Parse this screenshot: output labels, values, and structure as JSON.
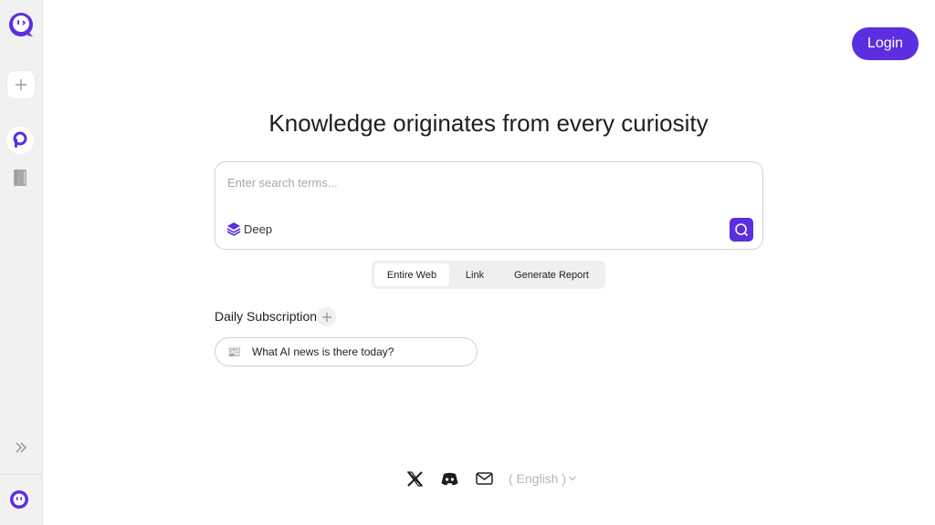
{
  "colors": {
    "accent": "#5b2ee0",
    "sidebar_bg": "#f1f1f1"
  },
  "sidebar": {
    "logo_icon": "robot-face-logo-icon",
    "new_icon": "plus-icon",
    "app_icon": "p-logo-icon",
    "library_icon": "book-icon",
    "expand_icon": "double-chevron-right-icon",
    "avatar_icon": "robot-face-avatar-icon"
  },
  "header": {
    "login_label": "Login"
  },
  "main": {
    "title": "Knowledge originates from every curiosity",
    "search": {
      "placeholder": "Enter search terms...",
      "value": "",
      "deep_label": "Deep",
      "deep_icon": "layers-icon",
      "submit_icon": "search-icon"
    },
    "tabs": [
      {
        "label": "Entire Web",
        "active": true
      },
      {
        "label": "Link",
        "active": false
      },
      {
        "label": "Generate Report",
        "active": false
      }
    ],
    "daily": {
      "label": "Daily Subscription",
      "add_icon": "plus-icon",
      "items": [
        {
          "icon": "📰",
          "text": "What AI news is there today?"
        }
      ]
    }
  },
  "footer": {
    "icons": [
      "x-logo-icon",
      "discord-icon",
      "mail-icon"
    ],
    "language": "( English )",
    "language_icon": "chevron-down-icon"
  }
}
